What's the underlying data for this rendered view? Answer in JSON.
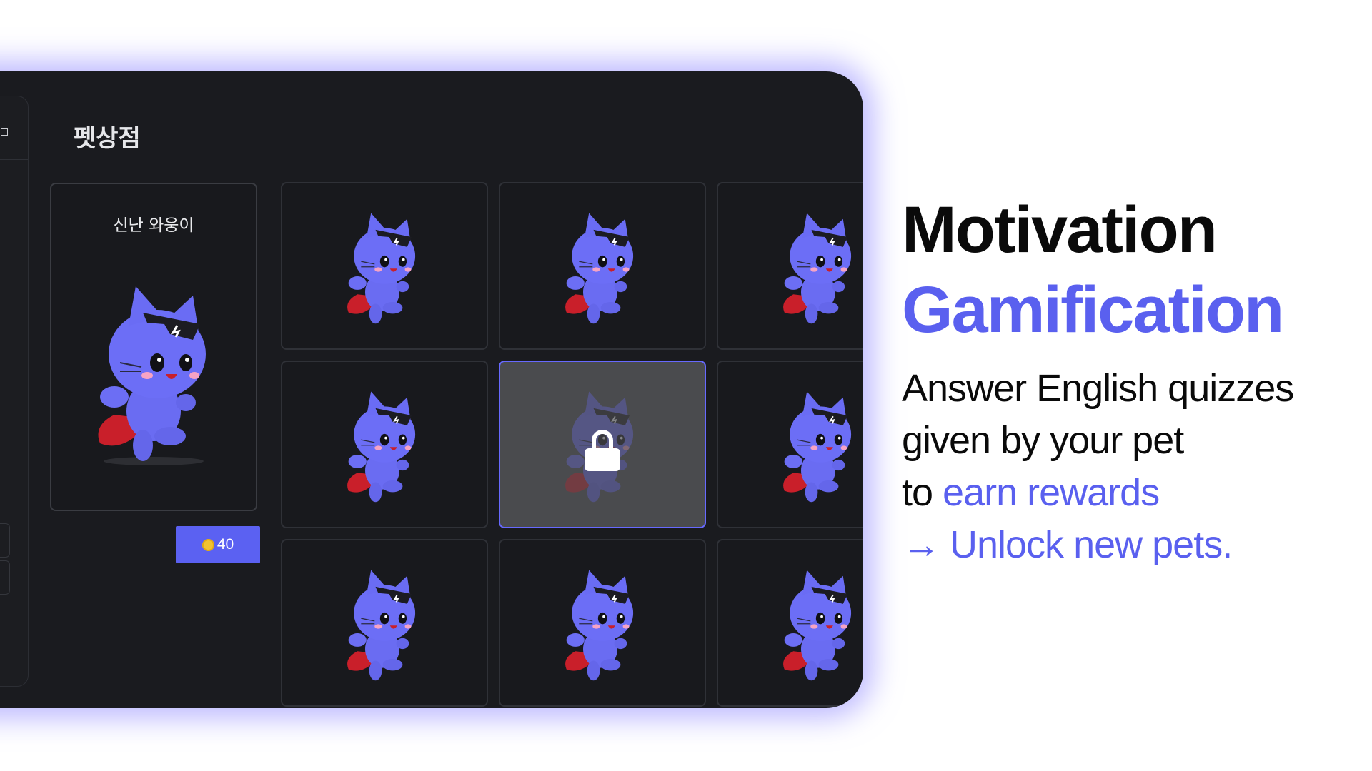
{
  "app": {
    "page_title": "펫상점"
  },
  "featured_pet": {
    "name": "신난 와웅이",
    "price": "40",
    "price_icon": "coin-icon"
  },
  "grid": {
    "cells": [
      {
        "state": "unlocked"
      },
      {
        "state": "unlocked"
      },
      {
        "state": "unlocked"
      },
      {
        "state": "unlocked"
      },
      {
        "state": "locked"
      },
      {
        "state": "unlocked"
      },
      {
        "state": "unlocked"
      },
      {
        "state": "unlocked"
      },
      {
        "state": "unlocked"
      }
    ]
  },
  "marketing": {
    "headline": "Motivation",
    "subheadline": "Gamification",
    "body_line1": "Answer English quizzes",
    "body_line2": "given by your pet",
    "body_line3_prefix": "to ",
    "body_line3_accent": "earn rewards",
    "body_line4": "→ Unlock new pets."
  },
  "colors": {
    "accent": "#5a60ef",
    "panel_bg": "#1a1b1f",
    "glow": "#8680ff",
    "price_button": "#5b61f2"
  }
}
